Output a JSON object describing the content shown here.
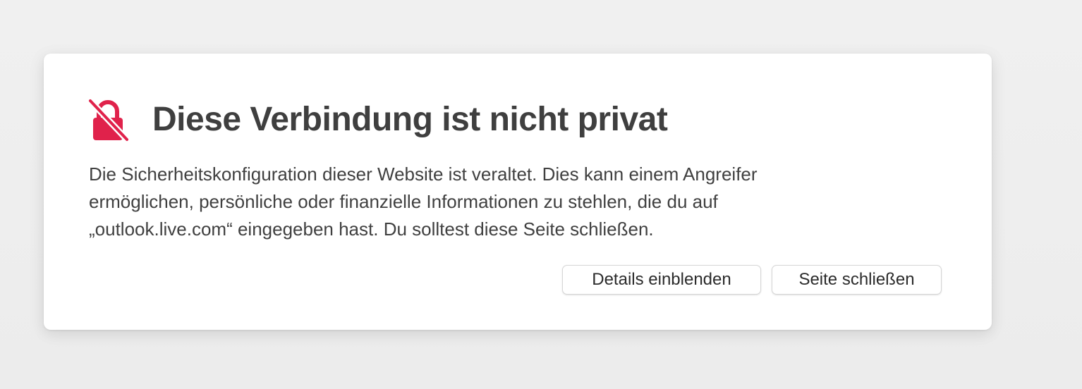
{
  "warning": {
    "icon": "lock-slash-icon",
    "icon_color": "#e0224b",
    "title": "Diese Verbindung ist nicht privat",
    "message": "Die Sicherheitskonfiguration dieser Website ist veraltet. Dies kann einem Angreifer ermöglichen, persönliche oder finanzielle Informationen zu stehlen, die du auf „outlook.live.com“ eingegeben hast. Du solltest diese Seite schließen.",
    "buttons": {
      "details_label": "Details einblenden",
      "close_label": "Seite schließen"
    }
  }
}
